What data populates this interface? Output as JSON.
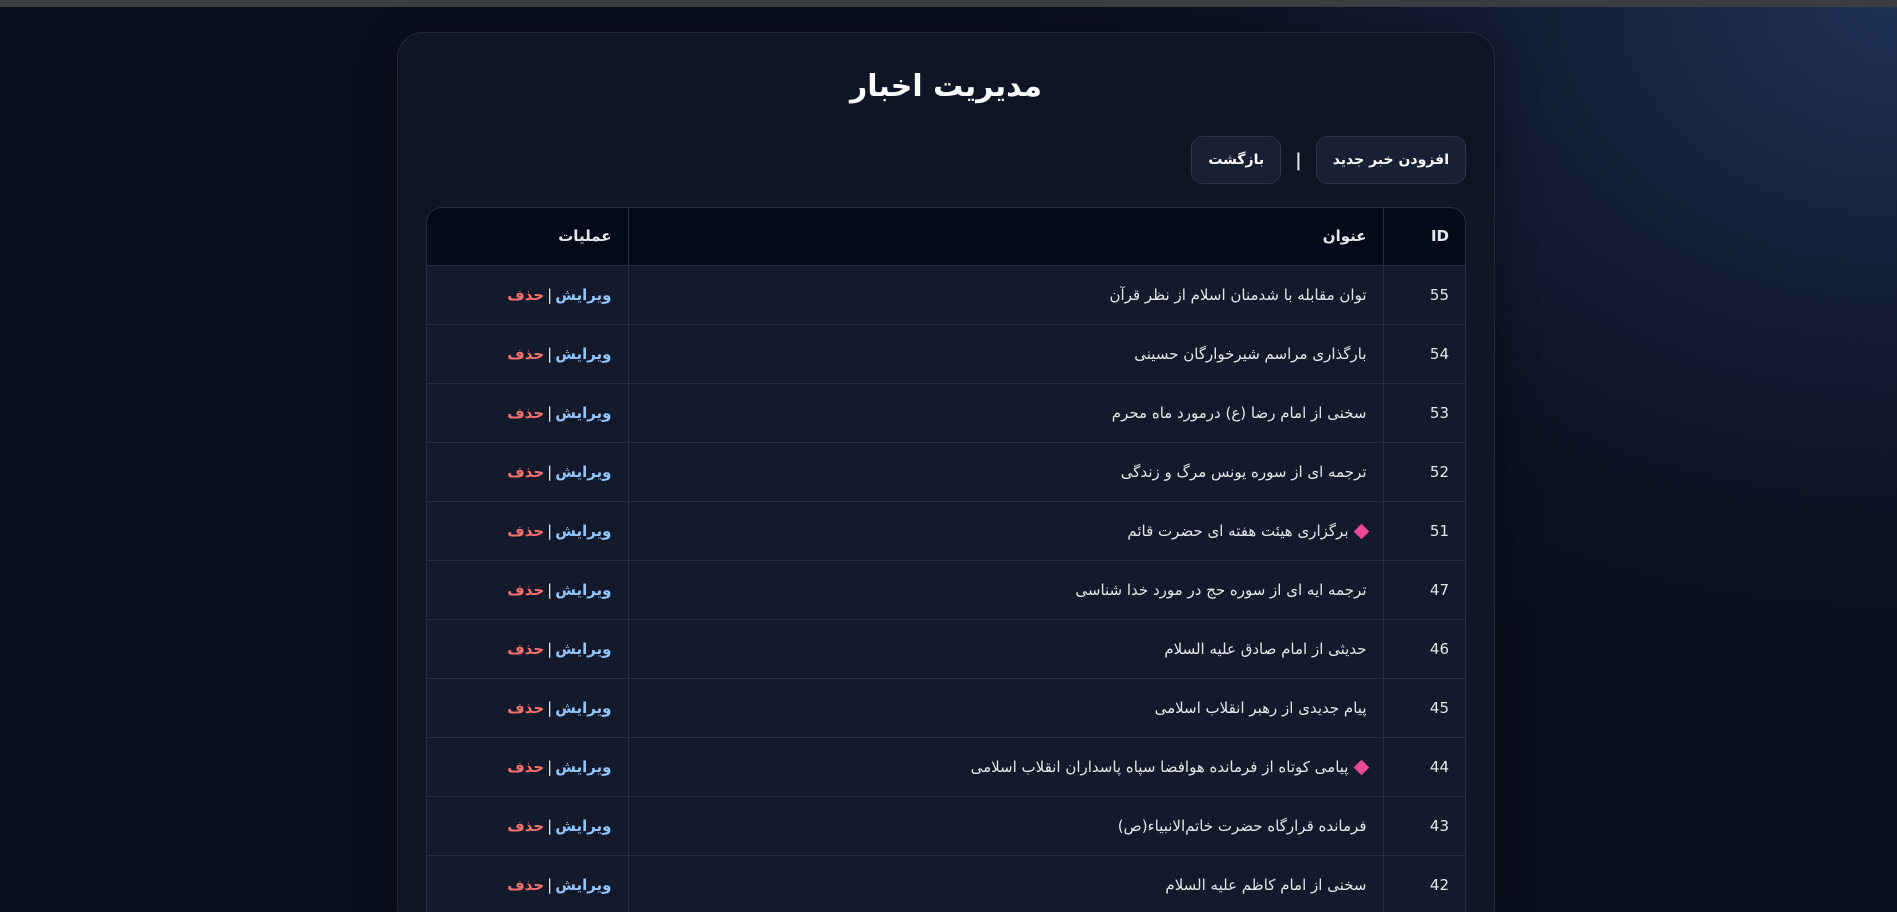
{
  "page_title": "مدیریت اخبار",
  "actions": {
    "add_label": "افزودن خبر جدید",
    "separator": "|",
    "back_label": "بازگشت"
  },
  "table": {
    "headers": {
      "id": "ID",
      "title": "عنوان",
      "operations": "عملیات"
    },
    "rows": [
      {
        "id": "55",
        "title": "توان مقابله با شدمنان اسلام از نظر قرآن",
        "pinned": false,
        "edit": "ویرایش",
        "sep": "|",
        "delete": "حذف"
      },
      {
        "id": "54",
        "title": "بارگذاری مراسم شیرخوارگان حسینی",
        "pinned": false,
        "edit": "ویرایش",
        "sep": "|",
        "delete": "حذف"
      },
      {
        "id": "53",
        "title": "سخنی از امام رضا (ع) درمورد ماه محرم",
        "pinned": false,
        "edit": "ویرایش",
        "sep": "|",
        "delete": "حذف"
      },
      {
        "id": "52",
        "title": "ترجمه ای از سوره یونس مرگ و زندگی",
        "pinned": false,
        "edit": "ویرایش",
        "sep": "|",
        "delete": "حذف"
      },
      {
        "id": "51",
        "title": "برگزاری هیئت هفته ای حضرت قائم",
        "pinned": true,
        "edit": "ویرایش",
        "sep": "|",
        "delete": "حذف"
      },
      {
        "id": "47",
        "title": "ترجمه ایه ای از سوره حج در مورد خدا شناسی",
        "pinned": false,
        "edit": "ویرایش",
        "sep": "|",
        "delete": "حذف"
      },
      {
        "id": "46",
        "title": "حدیثی از امام صادق علیه السلام",
        "pinned": false,
        "edit": "ویرایش",
        "sep": "|",
        "delete": "حذف"
      },
      {
        "id": "45",
        "title": "پیام جدیدی از رهبر انقلاب اسلامی",
        "pinned": false,
        "edit": "ویرایش",
        "sep": "|",
        "delete": "حذف"
      },
      {
        "id": "44",
        "title": "پیامی کوتاه از فرمانده هوافضا سپاه پاسداران انقلاب اسلامی",
        "pinned": true,
        "edit": "ویرایش",
        "sep": "|",
        "delete": "حذف"
      },
      {
        "id": "43",
        "title": "فرمانده قرارگاه حضرت خاتم‌الانبیاء(ص)",
        "pinned": false,
        "edit": "ویرایش",
        "sep": "|",
        "delete": "حذف"
      },
      {
        "id": "42",
        "title": "سخنی از امام کاظم علیه السلام",
        "pinned": false,
        "edit": "ویرایش",
        "sep": "|",
        "delete": "حذف"
      }
    ]
  },
  "colors": {
    "edit_link": "#93c5fd",
    "delete_link": "#f87171",
    "pin_marker": "#ec4899"
  }
}
